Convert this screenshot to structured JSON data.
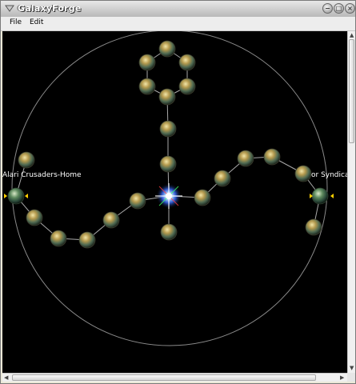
{
  "window": {
    "title": "GalaxyForge"
  },
  "menu": [
    {
      "label": "File"
    },
    {
      "label": "Edit"
    }
  ],
  "map": {
    "background": "#000000",
    "orbit_color": "#8a8a8a",
    "link_color": "#a9a9a9",
    "home_labels": [
      {
        "label": "Alari Crusaders-Home"
      },
      {
        "label": "or Syndicat"
      }
    ],
    "center_star": "central-star-icon"
  },
  "icons": {
    "minimize": "minimize-icon",
    "maximize": "maximize-icon",
    "close": "close-icon"
  }
}
